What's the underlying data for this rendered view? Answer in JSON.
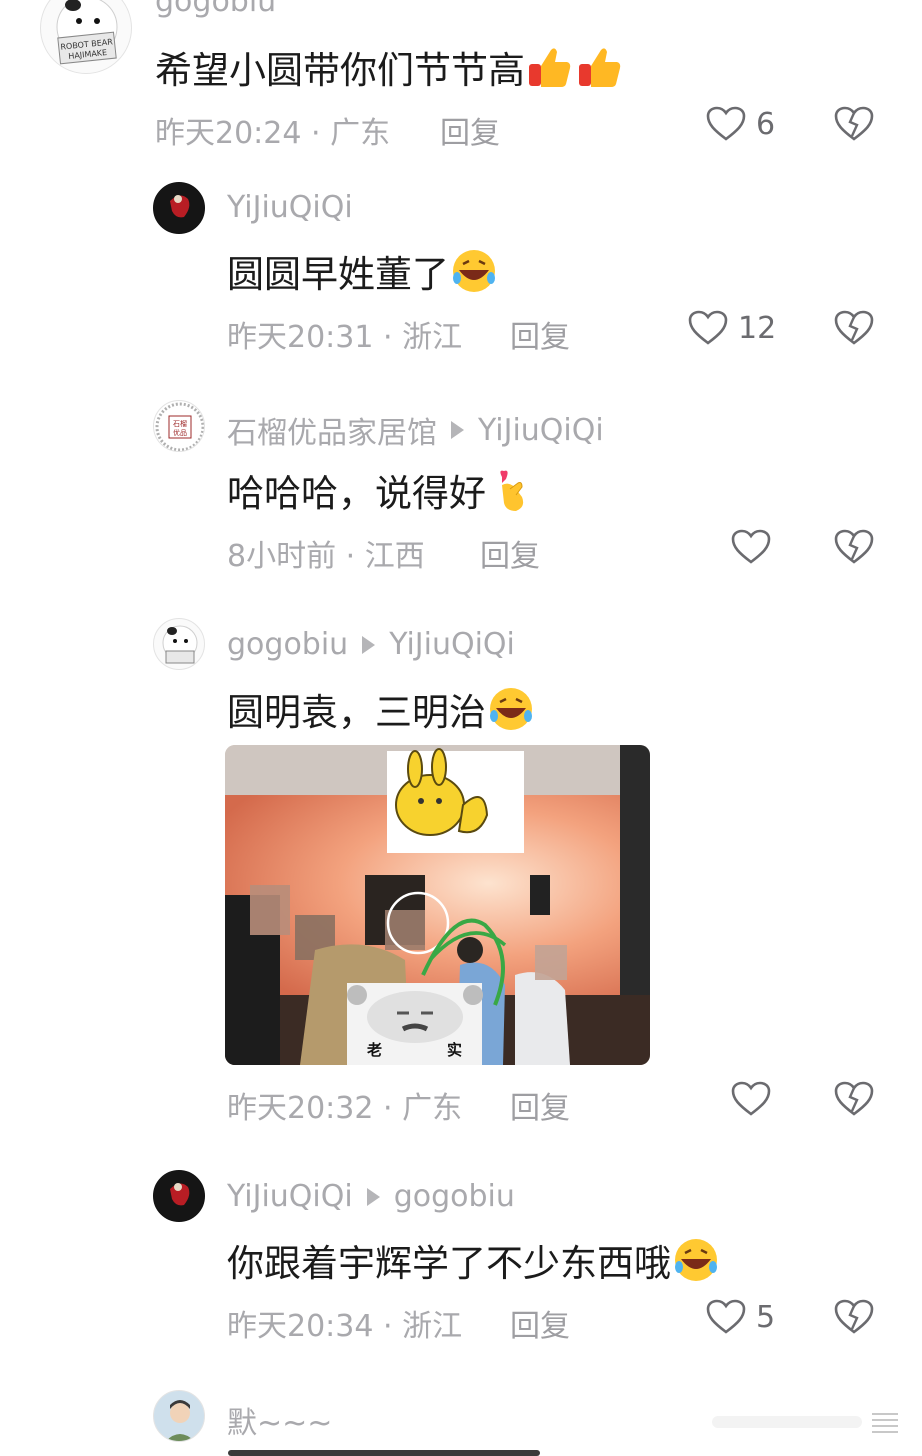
{
  "comments": [
    {
      "name": "gogobiu",
      "text": "希望小圆带你们节节高",
      "meta": "昨天20:24 · 广东",
      "reply": "回复",
      "likes": "6"
    },
    {
      "name": "YiJiuQiQi",
      "text": "圆圆早姓董了",
      "meta": "昨天20:31 · 浙江",
      "reply": "回复",
      "likes": "12"
    },
    {
      "name": "石榴优品家居馆",
      "reply_to": "YiJiuQiQi",
      "text": "哈哈哈，说得好",
      "meta": "8小时前 · 江西",
      "reply": "回复",
      "likes": ""
    },
    {
      "name": "gogobiu",
      "reply_to": "YiJiuQiQi",
      "text": "圆明袁，三明治",
      "meta": "昨天20:32 · 广东",
      "reply": "回复",
      "likes": "",
      "image_captions": [
        "老",
        "实"
      ]
    },
    {
      "name": "YiJiuQiQi",
      "reply_to": "gogobiu",
      "text": "你跟着宇辉学了不少东西哦",
      "meta": "昨天20:34 · 浙江",
      "reply": "回复",
      "likes": "5"
    },
    {
      "name": "默~~~"
    }
  ],
  "avatar_texts": {
    "robot_bear": [
      "ROBOT BEAR",
      "HAJIMAKE"
    ],
    "shop": [
      "石榴",
      "优品"
    ]
  },
  "colors": {
    "meta": "#a9a9ad",
    "text": "#1b1b1b",
    "icon": "#6b6b6f"
  }
}
